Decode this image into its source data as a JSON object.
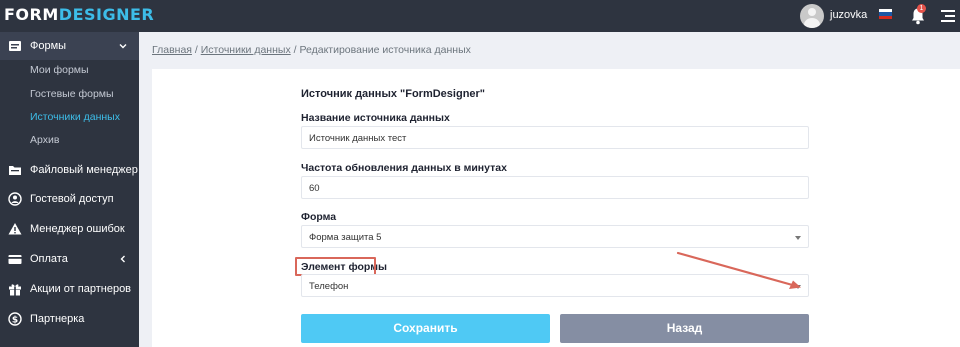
{
  "app": {
    "logo_part1": "FORM",
    "logo_part2": "DESIGNER",
    "username": "juzovka",
    "notification_count": "1"
  },
  "sidebar": {
    "items": [
      {
        "label": "Формы",
        "icon": "form-icon"
      },
      {
        "label": "Файловый менеджер",
        "icon": "folder-icon"
      },
      {
        "label": "Гостевой доступ",
        "icon": "user-icon"
      },
      {
        "label": "Менеджер ошибок",
        "icon": "warning-icon"
      },
      {
        "label": "Оплата",
        "icon": "card-icon"
      },
      {
        "label": "Акции от партнеров",
        "icon": "gift-icon"
      },
      {
        "label": "Партнерка",
        "icon": "dollar-icon"
      }
    ],
    "subitems": [
      "Мои формы",
      "Гостевые формы",
      "Источники данных",
      "Архив"
    ]
  },
  "breadcrumb": {
    "home": "Главная",
    "sep1": " / ",
    "sources": "Источники данных",
    "sep2": " / ",
    "current": "Редактирование источника данных"
  },
  "form": {
    "title": "Источник данных \"FormDesigner\"",
    "name_label": "Название источника данных",
    "name_value": "Источник данных тест",
    "freq_label": "Частота обновления данных в минутах",
    "freq_value": "60",
    "form_label": "Форма",
    "form_value": "Форма защита 5",
    "element_label": "Элемент формы",
    "element_value": "Телефон",
    "save_label": "Сохранить",
    "back_label": "Назад"
  },
  "colors": {
    "accent": "#3dbde8",
    "save": "#4fc9f4",
    "back": "#858ea3",
    "annotation": "#d9675a"
  }
}
